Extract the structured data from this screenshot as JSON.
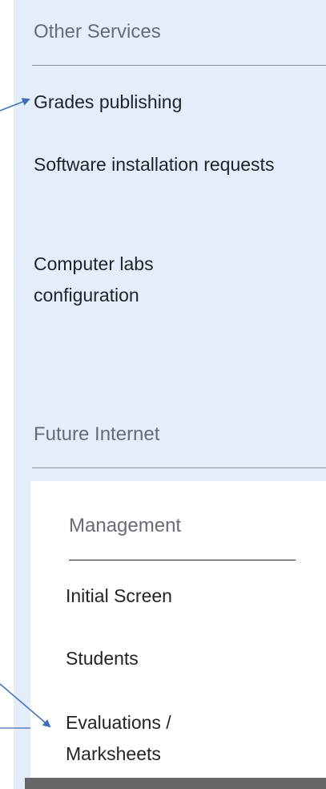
{
  "other_services": {
    "title": "Other Services",
    "items": [
      "Grades publishing",
      "Software installation requests",
      "Computer labs configuration"
    ]
  },
  "future_internet": {
    "title": "Future Internet",
    "management": {
      "title": "Management",
      "items": [
        "Initial Screen",
        "Students",
        "Evaluations / Marksheets"
      ]
    }
  },
  "colors": {
    "sidebar_bg": "#e5edfa",
    "annotation_arrow": "#3d6fb7",
    "section_title": "#666c77"
  }
}
